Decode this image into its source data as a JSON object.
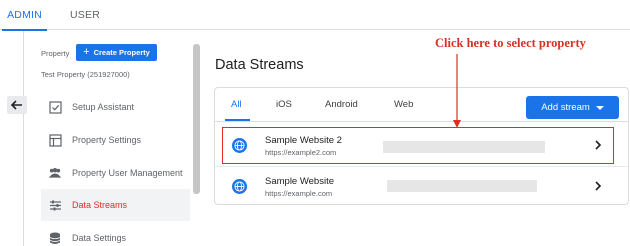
{
  "top_tabs": [
    {
      "label": "ADMIN"
    },
    {
      "label": "USER"
    }
  ],
  "property": {
    "label": "Property",
    "create_button": "Create Property",
    "name": "Test Property (251927000)"
  },
  "nav": {
    "items": [
      {
        "label": "Setup Assistant",
        "icon": "checkbox-icon"
      },
      {
        "label": "Property Settings",
        "icon": "settings-box-icon"
      },
      {
        "label": "Property User Management",
        "icon": "users-icon"
      },
      {
        "label": "Data Streams",
        "icon": "streams-icon",
        "active": true
      },
      {
        "label": "Data Settings",
        "icon": "database-icon"
      }
    ]
  },
  "main": {
    "title": "Data Streams",
    "tabs": [
      "All",
      "iOS",
      "Android",
      "Web"
    ],
    "add_stream": "Add stream",
    "streams": [
      {
        "name": "Sample Website 2",
        "url": "https://example2.com"
      },
      {
        "name": "Sample Website",
        "url": "https://example.com"
      }
    ]
  },
  "annotation": {
    "text": "Click here to select property"
  },
  "colors": {
    "accent": "#1a73e8",
    "annotation": "#d93025",
    "active_nav": "#d93025"
  }
}
